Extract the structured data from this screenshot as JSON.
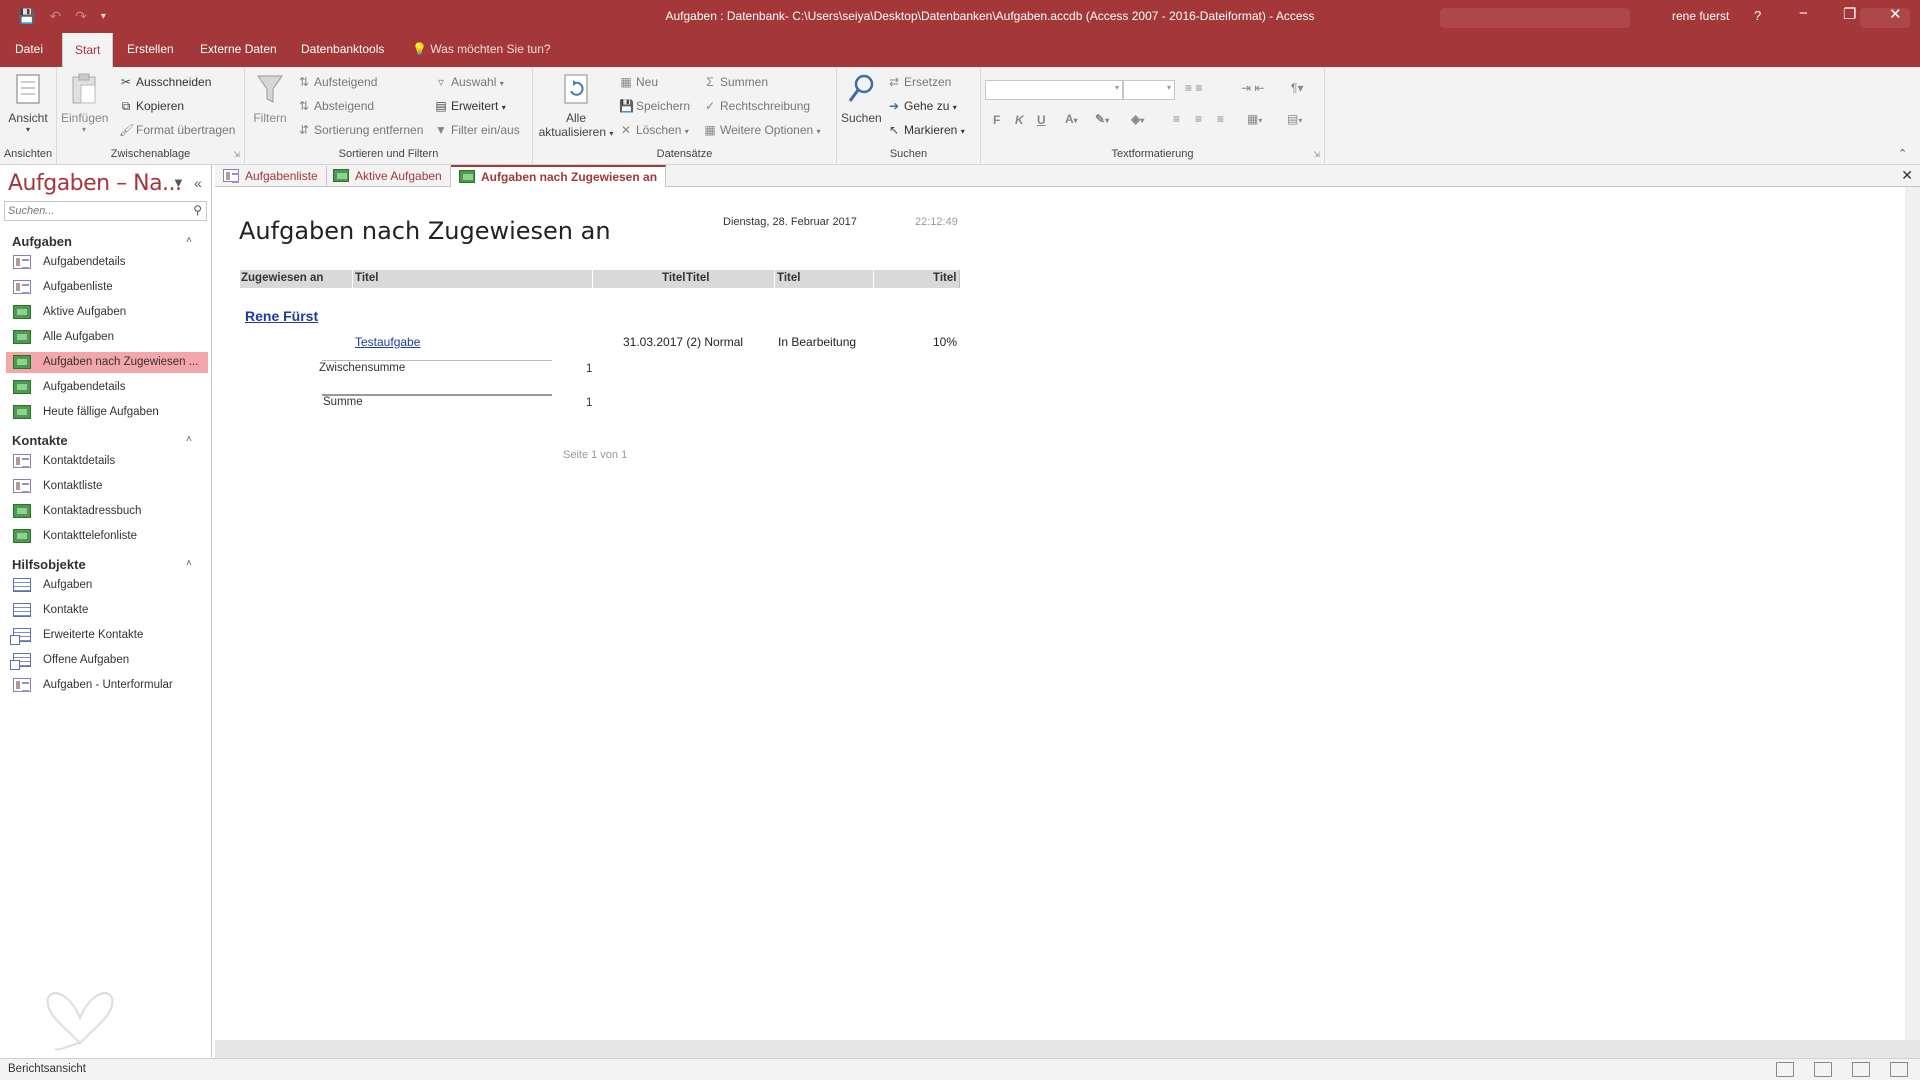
{
  "window": {
    "title": "Aufgaben : Datenbank- C:\\Users\\seiya\\Desktop\\Datenbanken\\Aufgaben.accdb (Access 2007 - 2016-Dateiformat)  -  Access",
    "user": "rene fuerst",
    "help": "?",
    "minimize": "−",
    "restore": "❐",
    "close": "✕"
  },
  "ribbon_tabs": [
    "Datei",
    "Start",
    "Erstellen",
    "Externe Daten",
    "Datenbanktools"
  ],
  "tell_me": "Was möchten Sie tun?",
  "ribbon": {
    "ansichten": {
      "button": "Ansicht",
      "label": "Ansichten"
    },
    "zwischenablage": {
      "paste": "Einfügen",
      "cut": "Ausschneiden",
      "copy": "Kopieren",
      "format": "Format übertragen",
      "label": "Zwischenablage"
    },
    "sortieren": {
      "filter": "Filtern",
      "asc": "Aufsteigend",
      "desc": "Absteigend",
      "remove": "Sortierung entfernen",
      "selection": "Auswahl",
      "advanced": "Erweitert",
      "toggle": "Filter ein/aus",
      "label": "Sortieren und Filtern"
    },
    "datensaetze": {
      "refresh_top": "Alle",
      "refresh_bottom": "aktualisieren",
      "new": "Neu",
      "save": "Speichern",
      "delete": "Löschen",
      "totals": "Summen",
      "spelling": "Rechtschreibung",
      "more": "Weitere Optionen",
      "label": "Datensätze"
    },
    "suchen": {
      "find": "Suchen",
      "replace": "Ersetzen",
      "goto": "Gehe zu",
      "select": "Markieren",
      "label": "Suchen"
    },
    "textformatierung": {
      "bold": "F",
      "italic": "K",
      "underline": "U",
      "label": "Textformatierung"
    }
  },
  "nav": {
    "title": "Aufgaben – Na...",
    "search_placeholder": "Suchen...",
    "groups": [
      {
        "name": "Aufgaben",
        "items": [
          {
            "label": "Aufgabendetails",
            "icon": "form-icon"
          },
          {
            "label": "Aufgabenliste",
            "icon": "form-icon"
          },
          {
            "label": "Aktive Aufgaben",
            "icon": "report-icon"
          },
          {
            "label": "Alle Aufgaben",
            "icon": "report-icon"
          },
          {
            "label": "Aufgaben nach Zugewiesen ...",
            "icon": "report-icon",
            "selected": true
          },
          {
            "label": "Aufgabendetails",
            "icon": "report-icon"
          },
          {
            "label": "Heute fällige Aufgaben",
            "icon": "report-icon"
          }
        ]
      },
      {
        "name": "Kontakte",
        "items": [
          {
            "label": "Kontaktdetails",
            "icon": "form-icon"
          },
          {
            "label": "Kontaktliste",
            "icon": "form-icon"
          },
          {
            "label": "Kontaktadressbuch",
            "icon": "report-icon"
          },
          {
            "label": "Kontakttelefonliste",
            "icon": "report-icon"
          }
        ]
      },
      {
        "name": "Hilfsobjekte",
        "items": [
          {
            "label": "Aufgaben",
            "icon": "table-icon"
          },
          {
            "label": "Kontakte",
            "icon": "table-icon"
          },
          {
            "label": "Erweiterte Kontakte",
            "icon": "query-icon"
          },
          {
            "label": "Offene Aufgaben",
            "icon": "query-icon"
          },
          {
            "label": "Aufgaben - Unterformular",
            "icon": "form-icon"
          }
        ]
      }
    ]
  },
  "doc_tabs": [
    {
      "label": "Aufgabenliste",
      "icon": "form-icon"
    },
    {
      "label": "Aktive Aufgaben",
      "icon": "report-icon"
    },
    {
      "label": "Aufgaben nach Zugewiesen an",
      "icon": "report-icon",
      "active": true
    }
  ],
  "report": {
    "title": "Aufgaben nach Zugewiesen an",
    "date": "Dienstag, 28. Februar 2017",
    "time": "22:12:49",
    "headers": {
      "assigned": "Zugewiesen an",
      "title1": "Titel",
      "title2": "Titel",
      "title3": "Titel",
      "title4": "Titel",
      "title5": "Titel"
    },
    "group": "Rene Fürst",
    "detail": {
      "task": "Testaufgabe",
      "due_priority": "31.03.2017 (2) Normal",
      "status": "In Bearbeitung",
      "percent": "10%"
    },
    "subtotal_label": "Zwischensumme",
    "subtotal_value": "1",
    "total_label": "Summe",
    "total_value": "1",
    "page_info": "Seite 1 von 1"
  },
  "status_bar": {
    "text": "Berichtsansicht"
  },
  "colors": {
    "accent": "#a4373a",
    "selected": "#f3a6ac",
    "link": "#1f3aa0"
  }
}
